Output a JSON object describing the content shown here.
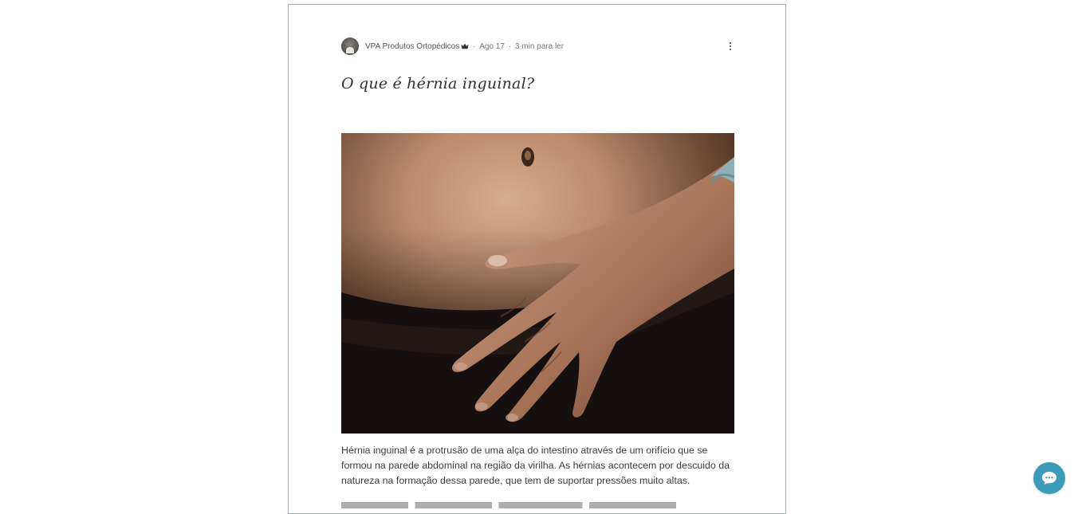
{
  "post": {
    "author": "VPA Produtos Ortopédicos",
    "date": "Ago 17",
    "read_time": "3 min para ler",
    "separator": "·",
    "title": "O que é hérnia inguinal?",
    "body": "Hérnia inguinal é a protrusão de uma alça do intestino através de um orifício que se formou na parede abdominal na região da virilha. As hérnias acontecem por descuido da natureza na formação dessa parede, que tem de suportar pressões muito altas."
  },
  "icons": {
    "author_badge": "crown-icon",
    "more_actions": "more-vertical-icon",
    "chat": "chat-bubble-icon"
  },
  "colors": {
    "card_border": "#9aaeb3",
    "title": "#2e3135",
    "body_text": "#3d3d3d",
    "chat_button": "#3e9ab9"
  }
}
